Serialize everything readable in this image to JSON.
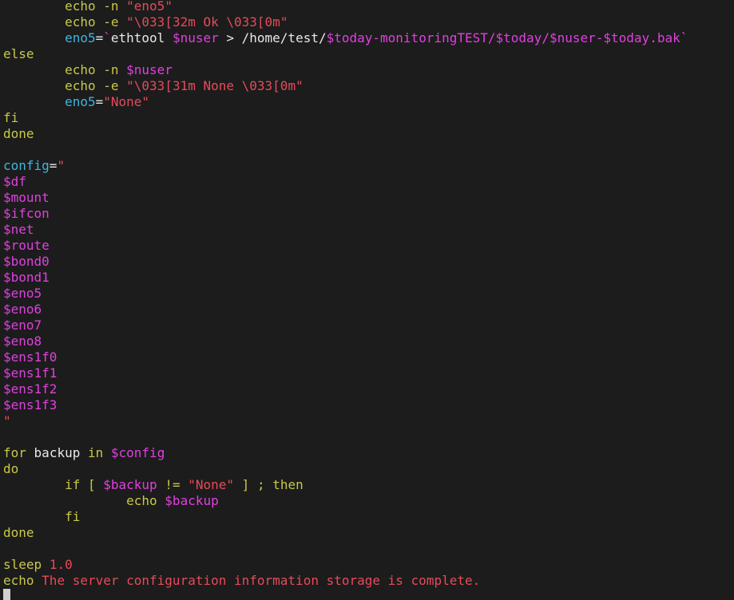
{
  "editor": {
    "cursor_shape": "block",
    "lines": [
      [
        {
          "t": "        "
        },
        {
          "t": "echo",
          "c": "y"
        },
        {
          "t": " "
        },
        {
          "t": "-n",
          "c": "y"
        },
        {
          "t": " "
        },
        {
          "t": "\"",
          "c": "r"
        },
        {
          "t": "eno5",
          "c": "r"
        },
        {
          "t": "\"",
          "c": "r"
        }
      ],
      [
        {
          "t": "        "
        },
        {
          "t": "echo",
          "c": "y"
        },
        {
          "t": " "
        },
        {
          "t": "-e",
          "c": "y"
        },
        {
          "t": " "
        },
        {
          "t": "\"",
          "c": "r"
        },
        {
          "t": "\\033[32m Ok \\033[0m",
          "c": "r"
        },
        {
          "t": "\"",
          "c": "r"
        }
      ],
      [
        {
          "t": "        "
        },
        {
          "t": "eno5",
          "c": "c"
        },
        {
          "t": "=",
          "c": "w"
        },
        {
          "t": "`",
          "c": "m"
        },
        {
          "t": "ethtool ",
          "c": "w"
        },
        {
          "t": "$nuser",
          "c": "m"
        },
        {
          "t": " > /home/test/",
          "c": "w"
        },
        {
          "t": "$today",
          "c": "m"
        },
        {
          "t": "-monitoringTEST/",
          "c": "m"
        },
        {
          "t": "$today",
          "c": "m"
        },
        {
          "t": "/",
          "c": "m"
        },
        {
          "t": "$nuser",
          "c": "m"
        },
        {
          "t": "-",
          "c": "m"
        },
        {
          "t": "$today",
          "c": "m"
        },
        {
          "t": ".bak",
          "c": "m"
        },
        {
          "t": "`",
          "c": "m"
        }
      ],
      [
        {
          "t": "else",
          "c": "y"
        }
      ],
      [
        {
          "t": "        "
        },
        {
          "t": "echo",
          "c": "y"
        },
        {
          "t": " "
        },
        {
          "t": "-n",
          "c": "y"
        },
        {
          "t": " "
        },
        {
          "t": "$nuser",
          "c": "m"
        }
      ],
      [
        {
          "t": "        "
        },
        {
          "t": "echo",
          "c": "y"
        },
        {
          "t": " "
        },
        {
          "t": "-e",
          "c": "y"
        },
        {
          "t": " "
        },
        {
          "t": "\"",
          "c": "r"
        },
        {
          "t": "\\033[31m None \\033[0m",
          "c": "r"
        },
        {
          "t": "\"",
          "c": "r"
        }
      ],
      [
        {
          "t": "        "
        },
        {
          "t": "eno5",
          "c": "c"
        },
        {
          "t": "=",
          "c": "w"
        },
        {
          "t": "\"None\"",
          "c": "r"
        }
      ],
      [
        {
          "t": "fi",
          "c": "y"
        }
      ],
      [
        {
          "t": "done",
          "c": "y"
        }
      ],
      [
        {
          "t": ""
        }
      ],
      [
        {
          "t": "config",
          "c": "c"
        },
        {
          "t": "=",
          "c": "w"
        },
        {
          "t": "\"",
          "c": "r"
        }
      ],
      [
        {
          "t": "$df",
          "c": "m"
        }
      ],
      [
        {
          "t": "$mount",
          "c": "m"
        }
      ],
      [
        {
          "t": "$ifcon",
          "c": "m"
        }
      ],
      [
        {
          "t": "$net",
          "c": "m"
        }
      ],
      [
        {
          "t": "$route",
          "c": "m"
        }
      ],
      [
        {
          "t": "$bond0",
          "c": "m"
        }
      ],
      [
        {
          "t": "$bond1",
          "c": "m"
        }
      ],
      [
        {
          "t": "$eno5",
          "c": "m"
        }
      ],
      [
        {
          "t": "$eno6",
          "c": "m"
        }
      ],
      [
        {
          "t": "$eno7",
          "c": "m"
        }
      ],
      [
        {
          "t": "$eno8",
          "c": "m"
        }
      ],
      [
        {
          "t": "$ens1f0",
          "c": "m"
        }
      ],
      [
        {
          "t": "$ens1f1",
          "c": "m"
        }
      ],
      [
        {
          "t": "$ens1f2",
          "c": "m"
        }
      ],
      [
        {
          "t": "$ens1f3",
          "c": "m"
        }
      ],
      [
        {
          "t": "\"",
          "c": "r"
        }
      ],
      [
        {
          "t": ""
        }
      ],
      [
        {
          "t": "for",
          "c": "y"
        },
        {
          "t": " "
        },
        {
          "t": "backup",
          "c": "w"
        },
        {
          "t": " "
        },
        {
          "t": "in",
          "c": "y"
        },
        {
          "t": " "
        },
        {
          "t": "$config",
          "c": "m"
        }
      ],
      [
        {
          "t": "do",
          "c": "y"
        }
      ],
      [
        {
          "t": "        "
        },
        {
          "t": "if",
          "c": "y"
        },
        {
          "t": " "
        },
        {
          "t": "[",
          "c": "y"
        },
        {
          "t": " "
        },
        {
          "t": "$backup",
          "c": "m"
        },
        {
          "t": " "
        },
        {
          "t": "!=",
          "c": "y"
        },
        {
          "t": " "
        },
        {
          "t": "\"None\"",
          "c": "r"
        },
        {
          "t": " "
        },
        {
          "t": "]",
          "c": "y"
        },
        {
          "t": " "
        },
        {
          "t": ";",
          "c": "y"
        },
        {
          "t": " "
        },
        {
          "t": "then",
          "c": "y"
        }
      ],
      [
        {
          "t": "                "
        },
        {
          "t": "echo",
          "c": "y"
        },
        {
          "t": " "
        },
        {
          "t": "$backup",
          "c": "m"
        }
      ],
      [
        {
          "t": "        "
        },
        {
          "t": "fi",
          "c": "y"
        }
      ],
      [
        {
          "t": "done",
          "c": "y"
        }
      ],
      [
        {
          "t": ""
        }
      ],
      [
        {
          "t": "sleep",
          "c": "y"
        },
        {
          "t": " "
        },
        {
          "t": "1.0",
          "c": "r"
        }
      ],
      [
        {
          "t": "echo",
          "c": "y"
        },
        {
          "t": " "
        },
        {
          "t": "The server configuration information storage is complete.",
          "c": "r"
        }
      ]
    ]
  },
  "colors": {
    "background": "#1c1c1c",
    "y": "#c8c84a",
    "r": "#e64b5a",
    "m": "#e040e0",
    "c": "#3fb6e0",
    "w": "#e8e8e8",
    "cursor": "#d0d0d0"
  }
}
